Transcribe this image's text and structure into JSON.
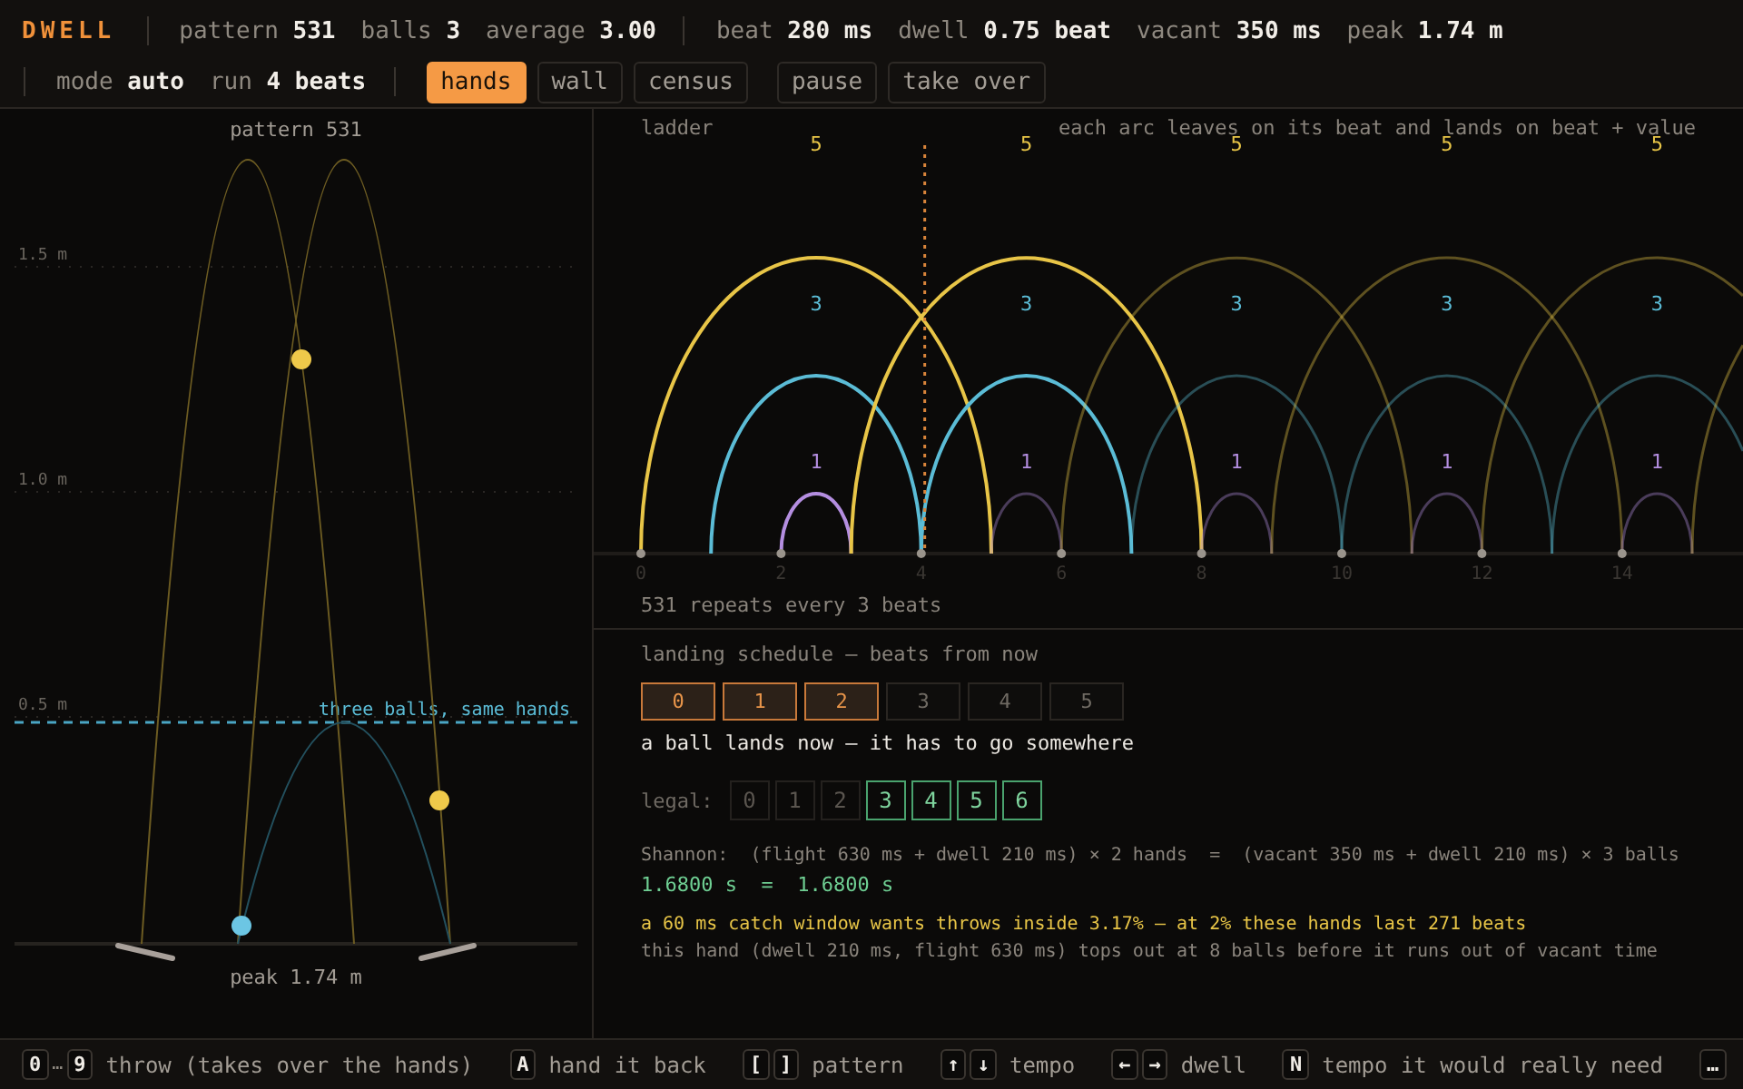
{
  "app": {
    "title": "DWELL"
  },
  "stat_groups": [
    [
      {
        "label": "pattern",
        "value": "531"
      },
      {
        "label": "balls",
        "value": "3"
      },
      {
        "label": "average",
        "value": "3.00"
      }
    ],
    [
      {
        "label": "beat",
        "value": "280 ms"
      },
      {
        "label": "dwell",
        "value": "0.75 beat"
      },
      {
        "label": "vacant",
        "value": "350 ms"
      },
      {
        "label": "peak",
        "value": "1.74 m"
      }
    ]
  ],
  "settings": [
    {
      "label": "mode",
      "value": "auto"
    },
    {
      "label": "run",
      "value": "4 beats"
    }
  ],
  "views": [
    {
      "label": "hands",
      "selected": true
    },
    {
      "label": "wall",
      "selected": false
    },
    {
      "label": "census",
      "selected": false
    }
  ],
  "actions": [
    "pause",
    "take over"
  ],
  "juggler": {
    "title": "pattern 531",
    "gridlines": [
      "1.5 m",
      "1.0 m",
      "0.5 m"
    ],
    "reference": "three balls, same hands",
    "caption": "peak 1.74 m"
  },
  "ladder": {
    "title": "ladder",
    "note": "each arc leaves on its beat and lands on beat + value",
    "ticks": [
      "0",
      "2",
      "4",
      "6",
      "8",
      "10",
      "12",
      "14"
    ],
    "groups": [
      {
        "throws": [
          {
            "value": "5",
            "lit": true
          },
          {
            "value": "3",
            "lit": true
          },
          {
            "value": "1",
            "lit": true
          }
        ]
      },
      {
        "throws": [
          {
            "value": "5",
            "lit": true
          },
          {
            "value": "3",
            "lit": true
          },
          {
            "value": "1",
            "lit": false
          }
        ]
      },
      {
        "throws": [
          {
            "value": "5",
            "lit": false
          },
          {
            "value": "3",
            "lit": false
          },
          {
            "value": "1",
            "lit": false
          }
        ]
      },
      {
        "throws": [
          {
            "value": "5",
            "lit": false
          },
          {
            "value": "3",
            "lit": false
          },
          {
            "value": "1",
            "lit": false
          }
        ]
      },
      {
        "throws": [
          {
            "value": "5",
            "lit": false
          },
          {
            "value": "3",
            "lit": false
          },
          {
            "value": "1",
            "lit": false
          }
        ]
      }
    ],
    "caption": "531 repeats every 3 beats"
  },
  "schedule": {
    "title": "landing schedule — beats from now",
    "slots": [
      {
        "label": "0",
        "filled": true
      },
      {
        "label": "1",
        "filled": true
      },
      {
        "label": "2",
        "filled": true
      },
      {
        "label": "3",
        "filled": false
      },
      {
        "label": "4",
        "filled": false
      },
      {
        "label": "5",
        "filled": false
      }
    ],
    "message": "a ball lands now — it has to go somewhere",
    "legal_label": "legal:",
    "legal": [
      {
        "label": "0",
        "allowed": false
      },
      {
        "label": "1",
        "allowed": false
      },
      {
        "label": "2",
        "allowed": false
      },
      {
        "label": "3",
        "allowed": true
      },
      {
        "label": "4",
        "allowed": true
      },
      {
        "label": "5",
        "allowed": true
      },
      {
        "label": "6",
        "allowed": true
      }
    ],
    "shannon": "Shannon:  (flight 630 ms + dwell 210 ms) × 2 hands  =  (vacant 350 ms + dwell 210 ms) × 3 balls",
    "result": "1.6800 s  =  1.6800 s",
    "warning": "a 60 ms catch window wants throws inside 3.17% — at 2% these hands last 271 beats",
    "note": "this hand (dwell 210 ms, flight 630 ms) tops out at 8 balls before it runs out of vacant time"
  },
  "shortcuts": [
    {
      "keys": [
        "0",
        "9"
      ],
      "joiner": "…",
      "label": "throw (takes over the hands)"
    },
    {
      "keys": [
        "A"
      ],
      "label": "hand it back"
    },
    {
      "keys": [
        "[",
        "]"
      ],
      "label": "pattern"
    },
    {
      "keys": [
        "↑",
        "↓"
      ],
      "label": "tempo"
    },
    {
      "keys": [
        "←",
        "→"
      ],
      "label": "dwell"
    },
    {
      "keys": [
        "N"
      ],
      "label": "tempo it would really need"
    },
    {
      "keys": [
        "…"
      ]
    }
  ]
}
